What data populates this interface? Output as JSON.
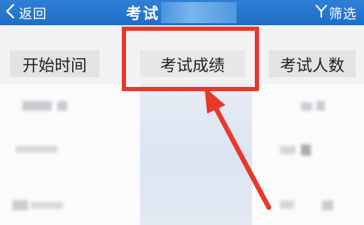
{
  "navbar": {
    "back_label": "返回",
    "title": "考试",
    "filter_label": "筛选"
  },
  "columns": {
    "start_time": "开始时间",
    "score": "考试成绩",
    "count": "考试人数"
  },
  "icons": {
    "back": "chevron-left-icon",
    "filter": "funnel-icon"
  },
  "colors": {
    "navbar": "#1f6ec6",
    "annotation": "#e8382c"
  }
}
